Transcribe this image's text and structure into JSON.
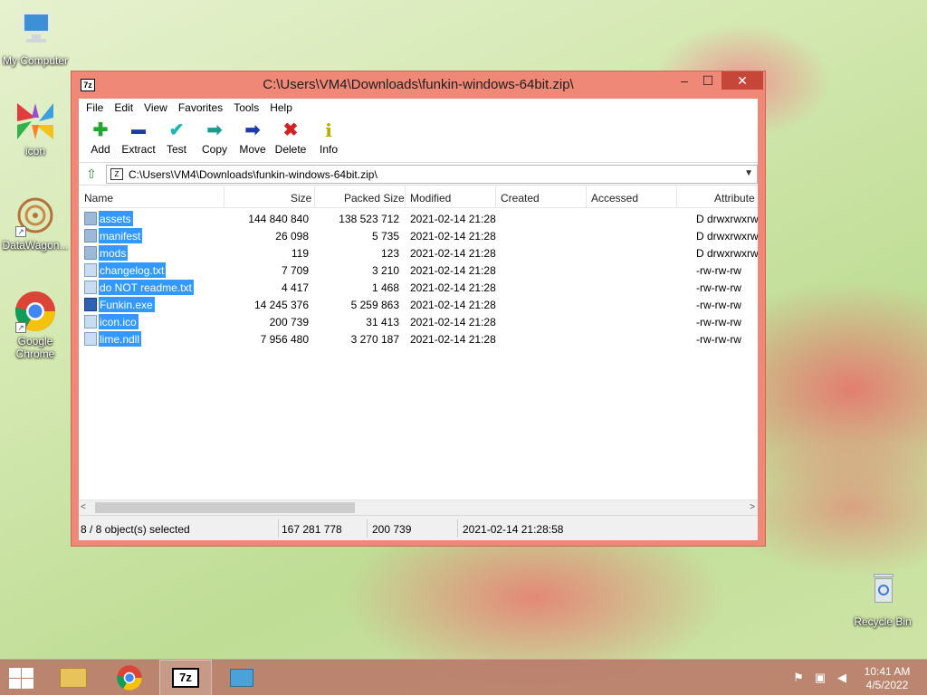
{
  "desktop": {
    "icons": [
      {
        "label": "My Computer"
      },
      {
        "label": "icon"
      },
      {
        "label": "DataWagon..."
      },
      {
        "label": "Google Chrome"
      },
      {
        "label": "Recycle Bin"
      }
    ]
  },
  "window": {
    "title": "C:\\Users\\VM4\\Downloads\\funkin-windows-64bit.zip\\",
    "app_icon_text": "7z",
    "controls": {
      "minimize": "–",
      "maximize": "☐",
      "close": "✕"
    }
  },
  "menu": [
    "File",
    "Edit",
    "View",
    "Favorites",
    "Tools",
    "Help"
  ],
  "toolbar": [
    {
      "label": "Add",
      "icon": "plus-icon",
      "glyph": "✚",
      "color": "#1fa82c"
    },
    {
      "label": "Extract",
      "icon": "minus-icon",
      "glyph": "▬",
      "color": "#1c3aa8"
    },
    {
      "label": "Test",
      "icon": "checkmark-icon",
      "glyph": "✔",
      "color": "#1bb5b5"
    },
    {
      "label": "Copy",
      "icon": "copy-arrow-icon",
      "glyph": "➡",
      "color": "#1a9c8c"
    },
    {
      "label": "Move",
      "icon": "move-arrow-icon",
      "glyph": "➡",
      "color": "#1c3aa8"
    },
    {
      "label": "Delete",
      "icon": "delete-x-icon",
      "glyph": "✖",
      "color": "#d42020"
    },
    {
      "label": "Info",
      "icon": "info-icon",
      "glyph": "i",
      "color": "#b8a800"
    }
  ],
  "address": {
    "path": "C:\\Users\\VM4\\Downloads\\funkin-windows-64bit.zip\\"
  },
  "columns": [
    "Name",
    "Size",
    "Packed Size",
    "Modified",
    "Created",
    "Accessed",
    "Attribute"
  ],
  "files": [
    {
      "name": "assets",
      "type": "folder",
      "size": "144 840 840",
      "packed": "138 523 712",
      "modified": "2021-02-14 21:28",
      "created": "",
      "accessed": "",
      "attr": "D drwxrwxrw"
    },
    {
      "name": "manifest",
      "type": "folder",
      "size": "26 098",
      "packed": "5 735",
      "modified": "2021-02-14 21:28",
      "created": "",
      "accessed": "",
      "attr": "D drwxrwxrw"
    },
    {
      "name": "mods",
      "type": "folder",
      "size": "119",
      "packed": "123",
      "modified": "2021-02-14 21:28",
      "created": "",
      "accessed": "",
      "attr": "D drwxrwxrw"
    },
    {
      "name": "changelog.txt",
      "type": "file",
      "size": "7 709",
      "packed": "3 210",
      "modified": "2021-02-14 21:28",
      "created": "",
      "accessed": "",
      "attr": "-rw-rw-rw"
    },
    {
      "name": "do NOT readme.txt",
      "type": "file",
      "size": "4 417",
      "packed": "1 468",
      "modified": "2021-02-14 21:28",
      "created": "",
      "accessed": "",
      "attr": "-rw-rw-rw"
    },
    {
      "name": "Funkin.exe",
      "type": "exe",
      "size": "14 245 376",
      "packed": "5 259 863",
      "modified": "2021-02-14 21:28",
      "created": "",
      "accessed": "",
      "attr": "-rw-rw-rw"
    },
    {
      "name": "icon.ico",
      "type": "file",
      "size": "200 739",
      "packed": "31 413",
      "modified": "2021-02-14 21:28",
      "created": "",
      "accessed": "",
      "attr": "-rw-rw-rw"
    },
    {
      "name": "lime.ndll",
      "type": "file",
      "size": "7 956 480",
      "packed": "3 270 187",
      "modified": "2021-02-14 21:28",
      "created": "",
      "accessed": "",
      "attr": "-rw-rw-rw"
    }
  ],
  "status": {
    "selected": "8 / 8 object(s) selected",
    "total_size": "167 281 778",
    "item_size": "200 739",
    "modified": "2021-02-14 21:28:58"
  },
  "taskbar": {
    "apps": [
      {
        "name": "file-explorer-icon"
      },
      {
        "name": "chrome-icon"
      },
      {
        "name": "7zip-icon",
        "text": "7z"
      },
      {
        "name": "installer-icon"
      }
    ],
    "clock": {
      "time": "10:41 AM",
      "date": "4/5/2022"
    }
  }
}
